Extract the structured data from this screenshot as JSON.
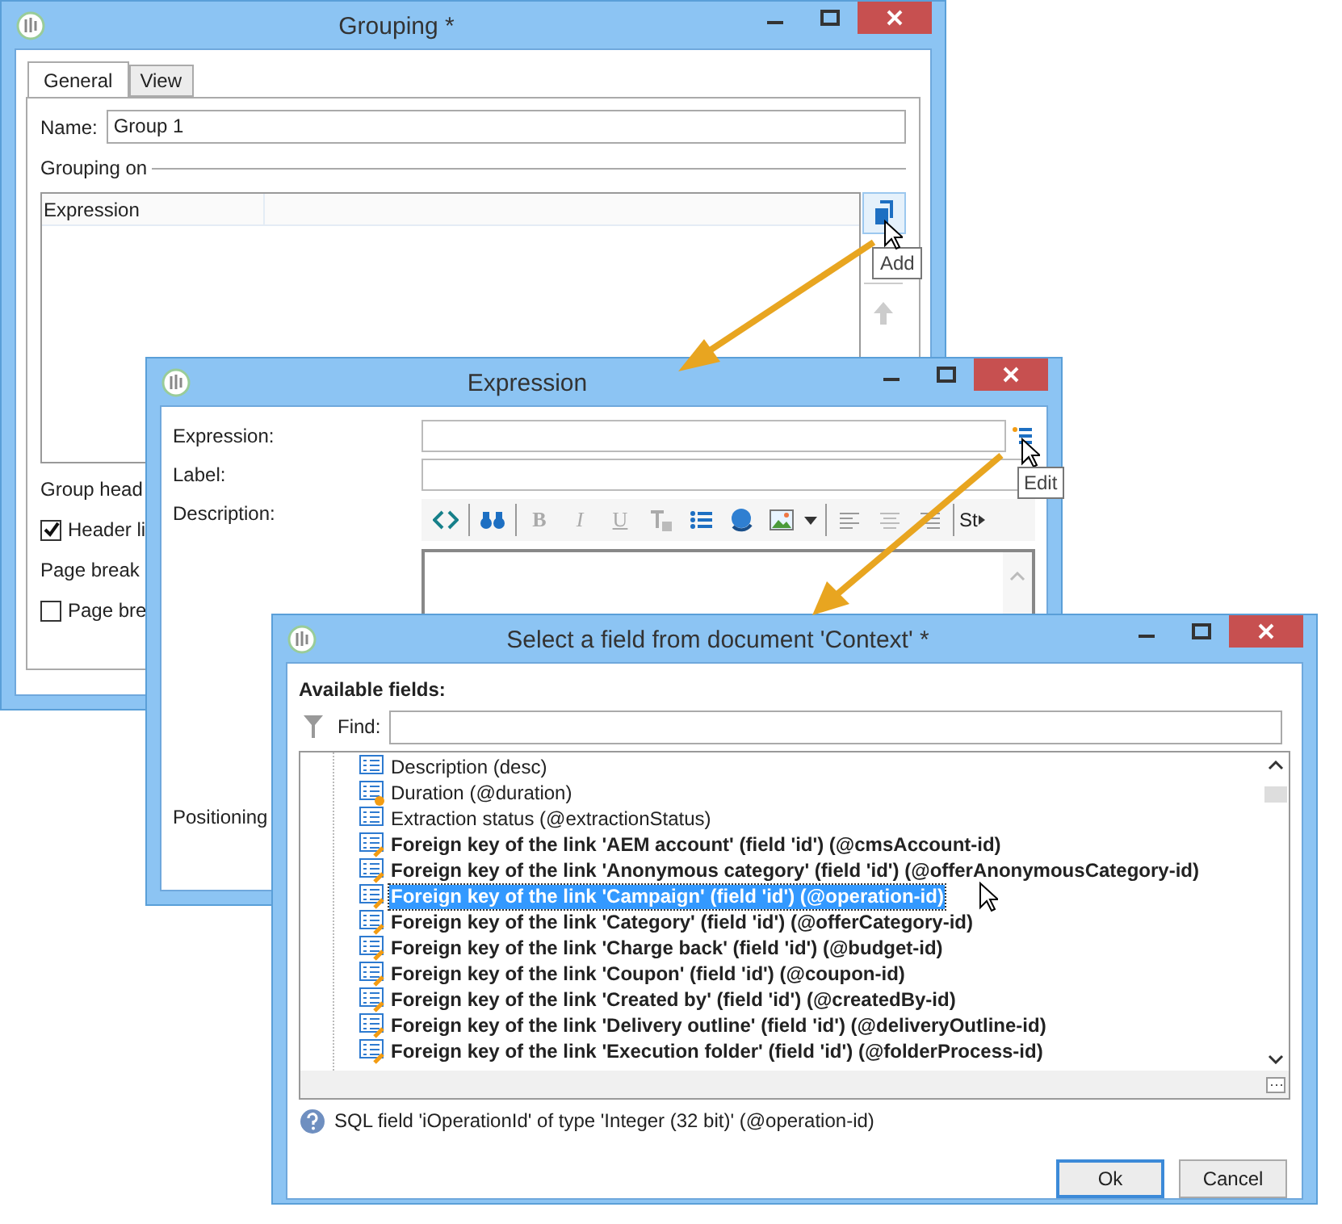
{
  "grouping": {
    "title": "Grouping *",
    "tabs": [
      {
        "label": "General",
        "selected": true
      },
      {
        "label": "View",
        "selected": false
      }
    ],
    "name_label": "Name:",
    "name_value": "Group 1",
    "section_label": "Grouping on",
    "column_header": "Expression",
    "add_tooltip": "Add",
    "group_header_label": "Group head",
    "header_checkbox": {
      "label": "Header li",
      "checked": true
    },
    "page_break_label": "Page break",
    "page_break_checkbox": {
      "label": "Page bre",
      "checked": false
    }
  },
  "expression": {
    "title": "Expression",
    "expression_label": "Expression:",
    "edit_tooltip": "Edit",
    "label_label": "Label:",
    "description_label": "Description:",
    "toolbar": [
      "B",
      "I",
      "U",
      "St"
    ],
    "positioning_label": "Positioning"
  },
  "select": {
    "title": "Select a field from document 'Context' *",
    "available_label": "Available fields:",
    "find_label": "Find:",
    "items": [
      {
        "label": "Description (desc)",
        "kind": "plain",
        "selected": false
      },
      {
        "label": "Duration (@duration)",
        "kind": "setting",
        "selected": false
      },
      {
        "label": "Extraction status (@extractionStatus)",
        "kind": "plain",
        "selected": false
      },
      {
        "label": "Foreign key of the link 'AEM account' (field 'id') (@cmsAccount-id)",
        "kind": "link",
        "selected": false
      },
      {
        "label": "Foreign key of the link 'Anonymous category' (field 'id') (@offerAnonymousCategory-id)",
        "kind": "link",
        "selected": false
      },
      {
        "label": "Foreign key of the link 'Campaign' (field 'id') (@operation-id)",
        "kind": "link",
        "selected": true
      },
      {
        "label": "Foreign key of the link 'Category' (field 'id') (@offerCategory-id)",
        "kind": "link",
        "selected": false
      },
      {
        "label": "Foreign key of the link 'Charge back' (field 'id') (@budget-id)",
        "kind": "link",
        "selected": false
      },
      {
        "label": "Foreign key of the link 'Coupon' (field 'id') (@coupon-id)",
        "kind": "link",
        "selected": false
      },
      {
        "label": "Foreign key of the link 'Created by' (field 'id') (@createdBy-id)",
        "kind": "link",
        "selected": false
      },
      {
        "label": "Foreign key of the link 'Delivery outline' (field 'id') (@deliveryOutline-id)",
        "kind": "link",
        "selected": false
      },
      {
        "label": "Foreign key of the link 'Execution folder' (field 'id') (@folderProcess-id)",
        "kind": "link",
        "selected": false
      }
    ],
    "status": "SQL field 'iOperationId' of type 'Integer (32 bit)' (@operation-id)",
    "buttons": [
      {
        "label": "Ok",
        "kind": "default"
      },
      {
        "label": "Cancel",
        "kind": "normal"
      }
    ]
  }
}
